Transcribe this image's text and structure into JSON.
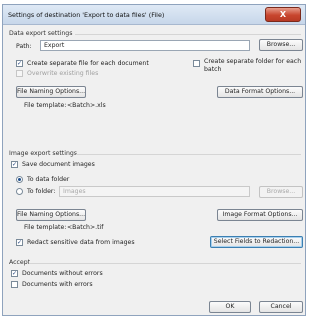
{
  "window": {
    "title": "Settings of destination 'Export to data files' (File)",
    "close_glyph": "X"
  },
  "data_export": {
    "section_label": "Data export settings",
    "path_label": "Path:",
    "path_value": "Export",
    "browse_label": "Browse...",
    "create_separate_file": {
      "label": "Create separate file for each document",
      "checked": true
    },
    "create_separate_folder": {
      "label": "Create separate folder for each batch",
      "checked": false
    },
    "overwrite_existing": {
      "label": "Overwrite existing files",
      "checked": false,
      "disabled": true
    },
    "file_naming_button": "File Naming Options...",
    "file_template_label": "File template:",
    "file_template_value": "<Batch>.xls",
    "data_format_button": "Data Format Options..."
  },
  "image_export": {
    "section_label": "Image export settings",
    "save_document_images": {
      "label": "Save document images",
      "checked": true
    },
    "to_data_folder": {
      "label": "To data folder",
      "selected": true
    },
    "to_folder": {
      "label": "To folder:",
      "selected": false
    },
    "folder_value": "Images",
    "browse_label": "Browse...",
    "file_naming_button": "File Naming Options...",
    "file_template_label": "File template:",
    "file_template_value": "<Batch>.tif",
    "image_format_button": "Image Format Options...",
    "redact": {
      "label": "Redact sensitive data from images",
      "checked": true
    },
    "select_fields_button": "Select Fields to Redaction..."
  },
  "accept": {
    "section_label": "Accept",
    "without_errors": {
      "label": "Documents without errors",
      "checked": true
    },
    "with_errors": {
      "label": "Documents with errors",
      "checked": false
    }
  },
  "footer": {
    "ok_label": "OK",
    "cancel_label": "Cancel"
  },
  "icons": {
    "checkmark": "✓"
  }
}
